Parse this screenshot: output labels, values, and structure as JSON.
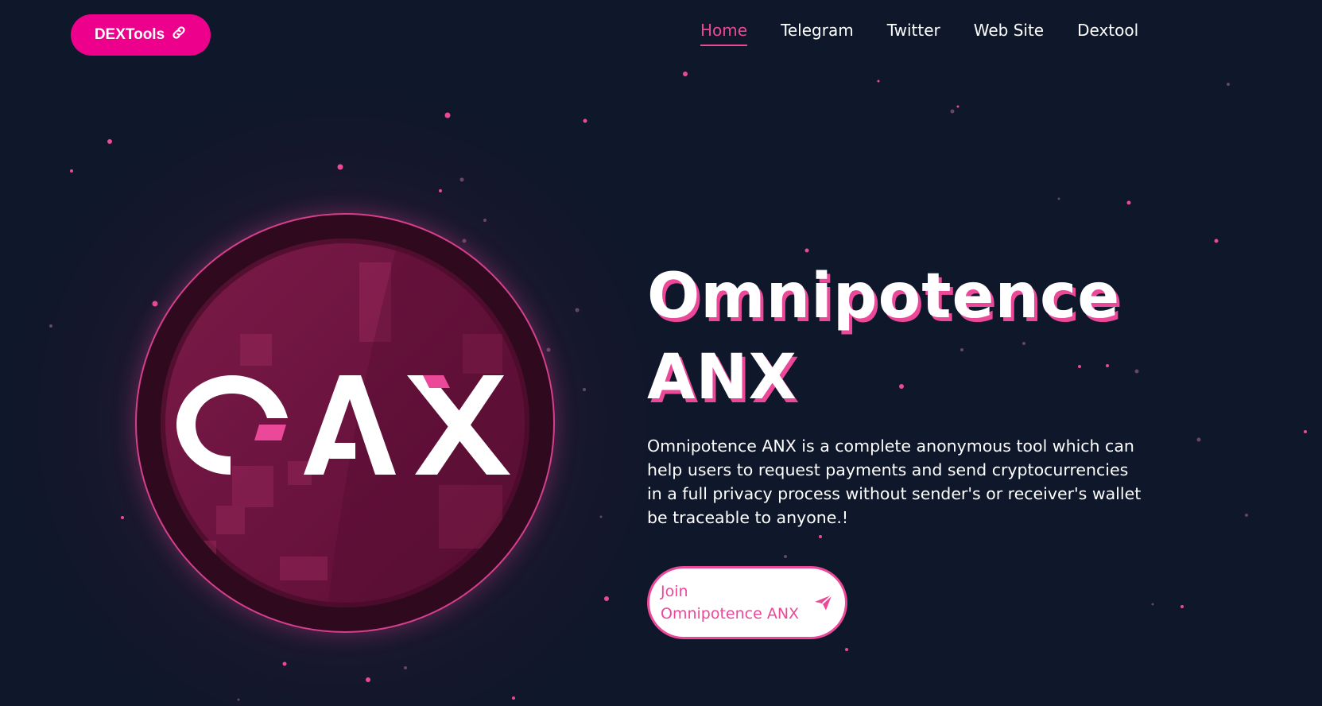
{
  "header": {
    "dextools_button": "DEXTools",
    "nav": [
      {
        "label": "Home",
        "active": true
      },
      {
        "label": "Telegram",
        "active": false
      },
      {
        "label": "Twitter",
        "active": false
      },
      {
        "label": "Web Site",
        "active": false
      },
      {
        "label": "Dextool",
        "active": false
      }
    ]
  },
  "logo": {
    "text": "OAX"
  },
  "hero": {
    "title_line1": "Omnipotence",
    "title_line2": "ANX",
    "description": "Omnipotence ANX is a complete anonymous tool which can help users to request payments and send cryptocurrencies in a full privacy process without sender's or receiver's wallet be traceable to anyone.!",
    "join_line1": "Join",
    "join_line2": "Omnipotence ANX"
  },
  "icons": {
    "dextools": "link-icon",
    "join": "send-icon"
  },
  "colors": {
    "background": "#0f172a",
    "accent": "#ec4899",
    "button": "#ec008c",
    "coin": "#6d1440"
  }
}
